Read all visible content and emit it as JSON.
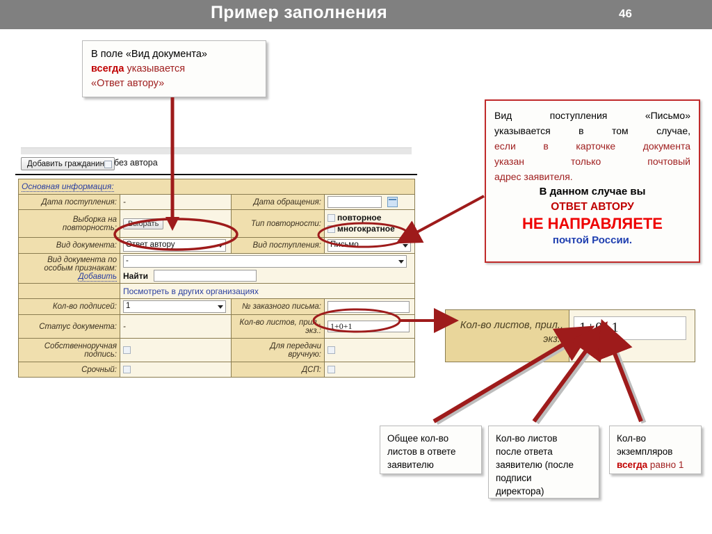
{
  "header": {
    "title": "Пример заполнения",
    "page_number": "46"
  },
  "callouts": {
    "doc_type": {
      "name": "doc-type-callout",
      "lines": [
        {
          "text": "В поле «Вид документа»",
          "color": "black"
        },
        {
          "text": "всегда",
          "color": "bold-red",
          "text2": " указывается",
          "color2": "dark-red"
        },
        {
          "text": "«Ответ автору»",
          "color": "dark-red"
        }
      ],
      "line1": "В поле «Вид документа»",
      "line2a": "всегда",
      "line2b": " указывается",
      "line3": "«Ответ автору»"
    },
    "receipt_type": {
      "line1": "Вид поступления «Письмо»",
      "line2": "указывается в том случае,",
      "line3": "если в карточке документа",
      "line4": "указан только почтовый",
      "line5": "адрес заявителя.",
      "line6": "В данном случае вы",
      "line7": "ОТВЕТ АВТОРУ",
      "line8": "НЕ НАПРАВЛЯЕТЕ",
      "line9": "почтой России."
    },
    "total_sheets": {
      "line1": "Общее кол-во",
      "line2": "листов в ответе",
      "line3": "заявителю"
    },
    "sheets_after": {
      "line1": "Кол-во листов",
      "line2": "после ответа",
      "line3": "заявителю (после",
      "line4": "подписи",
      "line5": "директора)"
    },
    "copies": {
      "line1": "Кол-во",
      "line2": "экземпляров",
      "line3a": "всегда",
      "line3b": " равно 1"
    }
  },
  "form": {
    "toolbar": {
      "add_citizen_button": "Добавить гражданина",
      "no_author_label": "без автора",
      "no_author_checked": false
    },
    "section_title": "Основная информация:",
    "rows": {
      "date_received": {
        "label": "Дата поступления:",
        "value": "-"
      },
      "date_appeal": {
        "label": "Дата обращения:",
        "value": ""
      },
      "repeat_selection": {
        "label": "Выборка на повторность:",
        "button": "Выбрать"
      },
      "repeat_type": {
        "label": "Тип повторности:",
        "option1": "повторное",
        "option2": "многократное",
        "option1_checked": false,
        "option2_checked": false
      },
      "doc_type": {
        "label": "Вид документа:",
        "value": "Ответ автору"
      },
      "receipt_type": {
        "label": "Вид поступления:",
        "value": "Письмо"
      },
      "doc_type_special": {
        "label_line1": "Вид документа по",
        "label_line2": "особым признакам:",
        "add_link": "Добавить",
        "select_value": "-",
        "find_label": "Найти",
        "find_value": ""
      },
      "other_orgs": {
        "link": "Посмотреть в других организациях"
      },
      "signatures_count": {
        "label": "Кол-во подписей:",
        "value": "1"
      },
      "registered_letter_no": {
        "label": "№ заказного письма:",
        "value": ""
      },
      "doc_status": {
        "label": "Статус документа:",
        "value": "-"
      },
      "sheets_count": {
        "label_line1": "Кол-во листов, прил.,",
        "label_line2": "экз.:",
        "value": "1+0+1"
      },
      "handwritten_signature": {
        "label": "Собственноручная подпись:",
        "checked": false
      },
      "hand_delivery": {
        "label": "Для передачи вручную:",
        "checked": false
      },
      "urgent": {
        "label": "Срочный:",
        "checked": false
      },
      "dsp": {
        "label": "ДСП:",
        "checked": false
      }
    }
  },
  "zoom_panel": {
    "label_line1": "Кол-во листов, прил.,",
    "label_line2": "экз.:",
    "value": "1+0+1"
  },
  "colors": {
    "header_bg": "#808080",
    "annotation_red": "#9e1b1b",
    "bright_red": "#ee0000",
    "dark_red": "#a02020",
    "blue": "#1f3fb0",
    "form_label_bg": "#f0dfae",
    "form_value_bg": "#faf5e4"
  }
}
